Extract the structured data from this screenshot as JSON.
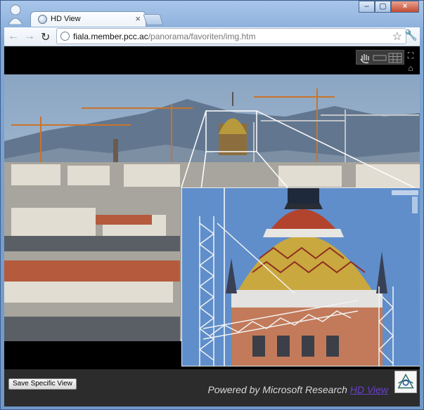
{
  "browser": {
    "tab_title": "HD View",
    "tab_close": "×",
    "url_host": "fiala.member.pcc.ac",
    "url_path": "/panorama/favoriten/img.htm",
    "back_icon": "←",
    "forward_icon": "→",
    "reload_icon": "↻",
    "star_icon": "☆",
    "wrench_icon": "🔧",
    "min_label": "–",
    "max_label": "▢",
    "close_label": "×"
  },
  "viewer": {
    "tool_icons": [
      "hand-icon",
      "panorama-icon",
      "grid-icon"
    ],
    "side_icons": [
      "full-screen-icon",
      "home-icon",
      "zoom-in-icon",
      "zoom-out-icon"
    ],
    "zoom_in_glyph": "+",
    "zoom_out_glyph": "−"
  },
  "footer": {
    "save_button_label": "Save Specific View",
    "powered_text": "Powered by Microsoft Research",
    "hdview_link": "HD View"
  },
  "colors": {
    "sky": "#8fa9c5",
    "mountain": "#5d728f",
    "crane": "#c8742b",
    "dome": "#b89a3c",
    "roof": "#b55a3d",
    "link": "#6a3fd2"
  }
}
